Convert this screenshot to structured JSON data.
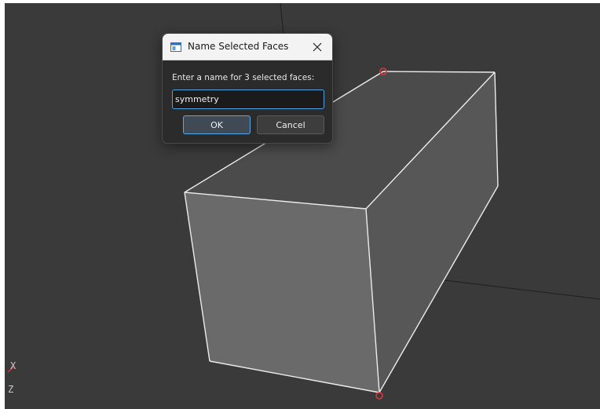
{
  "dialog": {
    "title": "Name Selected Faces",
    "prompt": "Enter a name for 3 selected faces:",
    "input_value": "symmetry",
    "ok_label": "OK",
    "cancel_label": "Cancel"
  },
  "axes": {
    "x_label": "X",
    "z_label": "Z"
  },
  "colors": {
    "viewport_background": "#3a3a3a",
    "box_front_face": "#6a6a6a",
    "box_side_face": "#575757",
    "box_top_face": "#4b4b4b",
    "edge_highlight": "#ececec",
    "vertex_marker": "#e0353b",
    "focus_accent": "#4ea3e0"
  },
  "icons": {
    "app": "window-app-icon",
    "close": "close-icon"
  }
}
